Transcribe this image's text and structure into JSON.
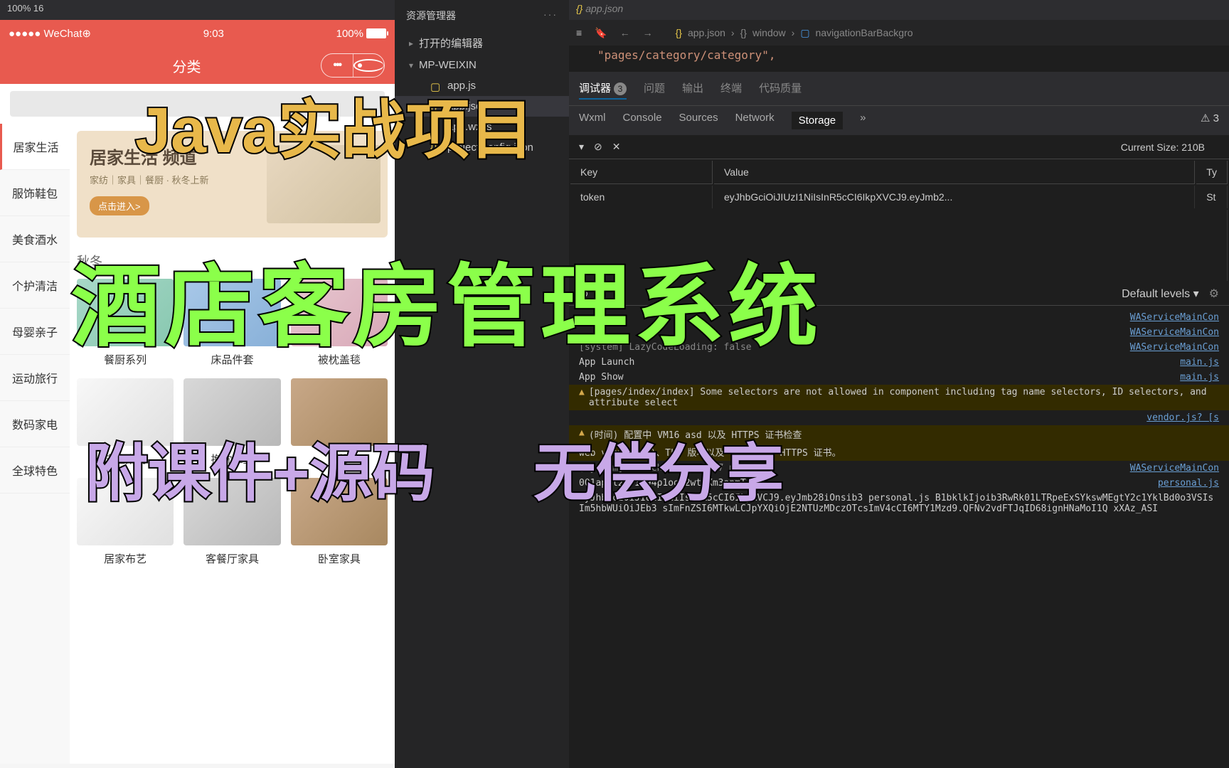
{
  "overlay": {
    "title1": "Java实战项目",
    "title2": "酒店客房管理系统",
    "title3a": "附课件+源码",
    "title3b": "无偿分享"
  },
  "sim_bar": "100% 16",
  "status": {
    "carrier": "●●●●● WeChat⊕",
    "time": "9:03",
    "battery": "100%"
  },
  "header": {
    "title": "分类"
  },
  "sidebar": {
    "items": [
      "居家生活",
      "服饰鞋包",
      "美食酒水",
      "个护清洁",
      "母婴亲子",
      "运动旅行",
      "数码家电",
      "全球特色"
    ]
  },
  "banner": {
    "title": "居家生活 频道",
    "sub": "家纺｜家具｜餐厨 · 秋冬上新",
    "btn": "点击进入>"
  },
  "section1": "秋冬",
  "products1": [
    {
      "label": "餐厨系列",
      "cls": "green"
    },
    {
      "label": "床品件套",
      "cls": "blue"
    },
    {
      "label": "被枕盖毯",
      "cls": "pink"
    }
  ],
  "products2": [
    {
      "label": "床垫桌椅",
      "cls": "white"
    },
    {
      "label": "抱枕靠垫",
      "cls": "grey"
    },
    {
      "label": "家饰",
      "cls": "brown"
    }
  ],
  "products3": [
    {
      "label": "居家布艺",
      "cls": "white"
    },
    {
      "label": "客餐厅家具",
      "cls": "grey"
    },
    {
      "label": "卧室家具",
      "cls": "brown"
    }
  ],
  "explorer": {
    "title": "资源管理器",
    "sections": [
      "打开的编辑器",
      "MP-WEIXIN"
    ],
    "files": [
      "app.js",
      "app.json",
      "app.wxss",
      "project.config.json"
    ]
  },
  "ide": {
    "tab": "app.json",
    "breadcrumb": [
      "app.json",
      "window",
      "navigationBarBackgro"
    ],
    "code_line": "\"pages/category/category\",",
    "debug_tabs": {
      "debugger": "调试器",
      "badge": "3",
      "problems": "问题",
      "output": "输出",
      "terminal": "终端",
      "quality": "代码质量"
    },
    "devtools": [
      "Wxml",
      "Console",
      "Sources",
      "Network",
      "Storage"
    ],
    "devtools_more": "»",
    "storage_size": "Current Size: 210B",
    "table": {
      "key_h": "Key",
      "val_h": "Value",
      "type_h": "Ty",
      "key": "token",
      "val": "eyJhbGciOiJIUzI1NiIsInR5cCI6IkpXVCJ9.eyJmb2...",
      "type": "St"
    },
    "filter": {
      "levels": "Default levels"
    },
    "console": [
      {
        "type": "plain",
        "msg": "",
        "src": "WAServiceMainCon"
      },
      {
        "type": "plain",
        "msg": "",
        "src": "WAServiceMainCon"
      },
      {
        "type": "sys",
        "msg": "[system] LazyCodeLoading: false",
        "src": "WAServiceMainCon"
      },
      {
        "type": "plain",
        "msg": "App Launch",
        "src": "main.js"
      },
      {
        "type": "plain",
        "msg": "App Show",
        "src": "main.js"
      },
      {
        "type": "warn",
        "msg": "[pages/index/index] Some selectors are not allowed in component including tag name selectors, ID selectors, and attribute select",
        "src": ""
      },
      {
        "type": "plain",
        "msg": "",
        "src": "vendor.js? [s"
      },
      {
        "type": "warn",
        "msg": "(时间) 配置中  VM16 asd  以及 HTTPS 证书检查",
        "src": ""
      },
      {
        "type": "warn",
        "msg": "web view（业务）、TLS 版本以及  VM16 asd HTTPS 证书。",
        "src": ""
      },
      {
        "type": "sys",
        "msg": "[system] Launch Time: 5117 ms",
        "src": "WAServiceMainCon"
      },
      {
        "type": "plain",
        "msg": "001apml2bfIm94p1ool2wt4Xm3apmT",
        "src": "personal.js"
      },
      {
        "type": "plain",
        "msg": "eyJhbGciOiJIUzI1NiIsInR5cCI6IkpXVCJ9.eyJmb28iOnsib3 personal.js B1bklkIjoib3RwRk01LTRpeExSYkswMEgtY2c1YklBd0o3VSIsIm5hbWUiOiJEb3 sImFnZSI6MTkwLCJpYXQiOjE2NTUzMDczOTcsImV4cCI6MTY1Mzd9.QFNv2vdFTJqID68ignHNaMoI1Q xXAz_ASI",
        "src": ""
      }
    ]
  }
}
